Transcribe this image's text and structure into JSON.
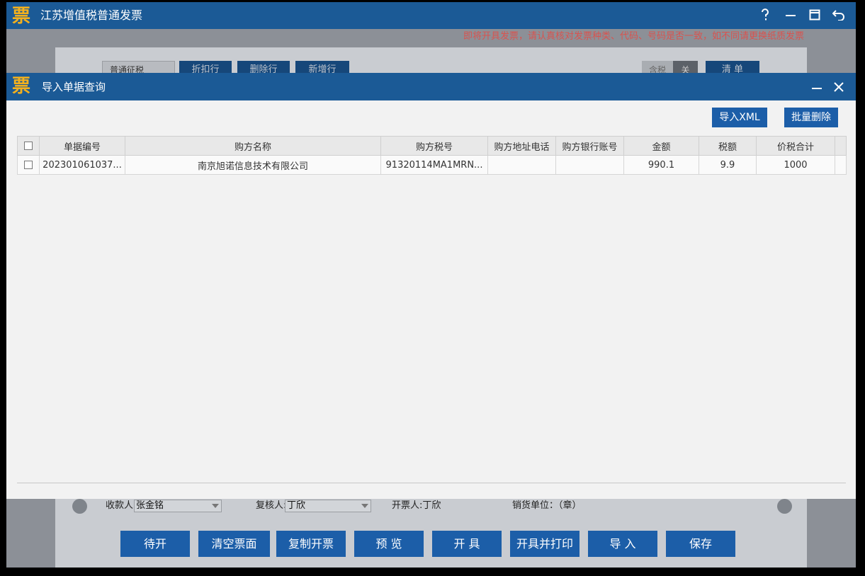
{
  "app": {
    "title": "江苏增值税普通发票",
    "logo_char": "票",
    "warning": "即将开具发票，请认真核对发票种类、代码、号码是否一致，如不同请更换纸质发票"
  },
  "toolbar": {
    "tax_type": "普通征税",
    "btn_discount": "折扣行",
    "btn_delete_row": "删除行",
    "btn_new_row": "新增行",
    "toggle_left": "含税",
    "toggle_right": "关",
    "btn_list": "清 单"
  },
  "footer_fields": {
    "payee_label": "收款人:",
    "payee_value": "张金铭",
    "reviewer_label": "复核人:",
    "reviewer_value": "丁欣",
    "drawer": "开票人:丁欣",
    "seller": "销货单位：（章）"
  },
  "actions": [
    "待开",
    "清空票面",
    "复制开票",
    "预 览",
    "开 具",
    "开具并打印",
    "导 入",
    "保存"
  ],
  "dialog": {
    "title": "导入单据查询",
    "btn_import_xml": "导入XML",
    "btn_batch_delete": "批量删除",
    "columns": [
      "单据编号",
      "购方名称",
      "购方税号",
      "购方地址电话",
      "购方银行账号",
      "金额",
      "税额",
      "价税合计"
    ],
    "rows": [
      {
        "doc_no": "202301061037...",
        "buyer_name": "南京旭诺信息技术有限公司",
        "buyer_tax_id": "91320114MA1MRN...",
        "buyer_addr_phone": "",
        "buyer_bank": "",
        "amount": "990.1",
        "tax": "9.9",
        "total": "1000"
      }
    ]
  },
  "colors": {
    "title_bar": "#1b5a96",
    "button": "#1c5ea8",
    "logo": "#f2b01e",
    "warning": "#d9534f"
  },
  "icons": [
    "help-icon",
    "minimize-icon",
    "restore-icon",
    "back-icon",
    "close-icon",
    "chevron-down-icon"
  ]
}
